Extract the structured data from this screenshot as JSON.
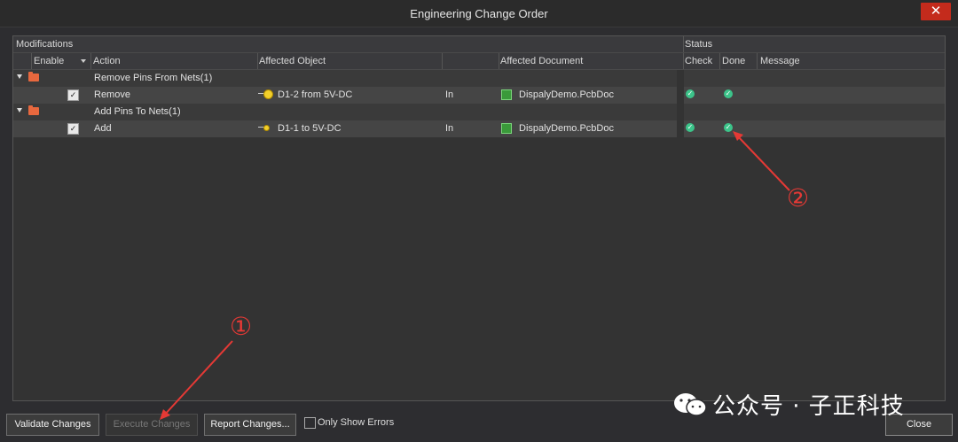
{
  "window": {
    "title": "Engineering Change Order",
    "close_glyph": "✕"
  },
  "header": {
    "group_modifications": "Modifications",
    "group_status": "Status",
    "columns": {
      "enable": "Enable",
      "action": "Action",
      "affected_object": "Affected Object",
      "affected_document": "Affected Document",
      "check": "Check",
      "done": "Done",
      "message": "Message"
    }
  },
  "rows": [
    {
      "type": "group",
      "action": "Remove Pins From Nets(1)"
    },
    {
      "type": "item",
      "enabled": true,
      "action": "Remove",
      "object_icon": "pin-remove-icon",
      "object": "D1-2 from 5V-DC",
      "relation": "In",
      "document_icon": "pcb-document-icon",
      "document": "DispalyDemo.PcbDoc",
      "check": "ok",
      "done": "ok"
    },
    {
      "type": "group",
      "action": "Add Pins To Nets(1)"
    },
    {
      "type": "item",
      "enabled": true,
      "action": "Add",
      "object_icon": "pin-add-icon",
      "object": "D1-1 to 5V-DC",
      "relation": "In",
      "document_icon": "pcb-document-icon",
      "document": "DispalyDemo.PcbDoc",
      "check": "ok",
      "done": "ok"
    }
  ],
  "footer": {
    "validate": "Validate Changes",
    "execute": "Execute Changes",
    "report": "Report Changes...",
    "only_errors": "Only Show Errors",
    "close": "Close"
  },
  "annotations": {
    "first": "①",
    "second": "②",
    "color": "#e53935"
  },
  "watermark": {
    "text": "公众号 · 子正科技"
  },
  "colors": {
    "ok": "#3cc48a",
    "folder": "#e8683e",
    "close": "#c42b1c"
  }
}
